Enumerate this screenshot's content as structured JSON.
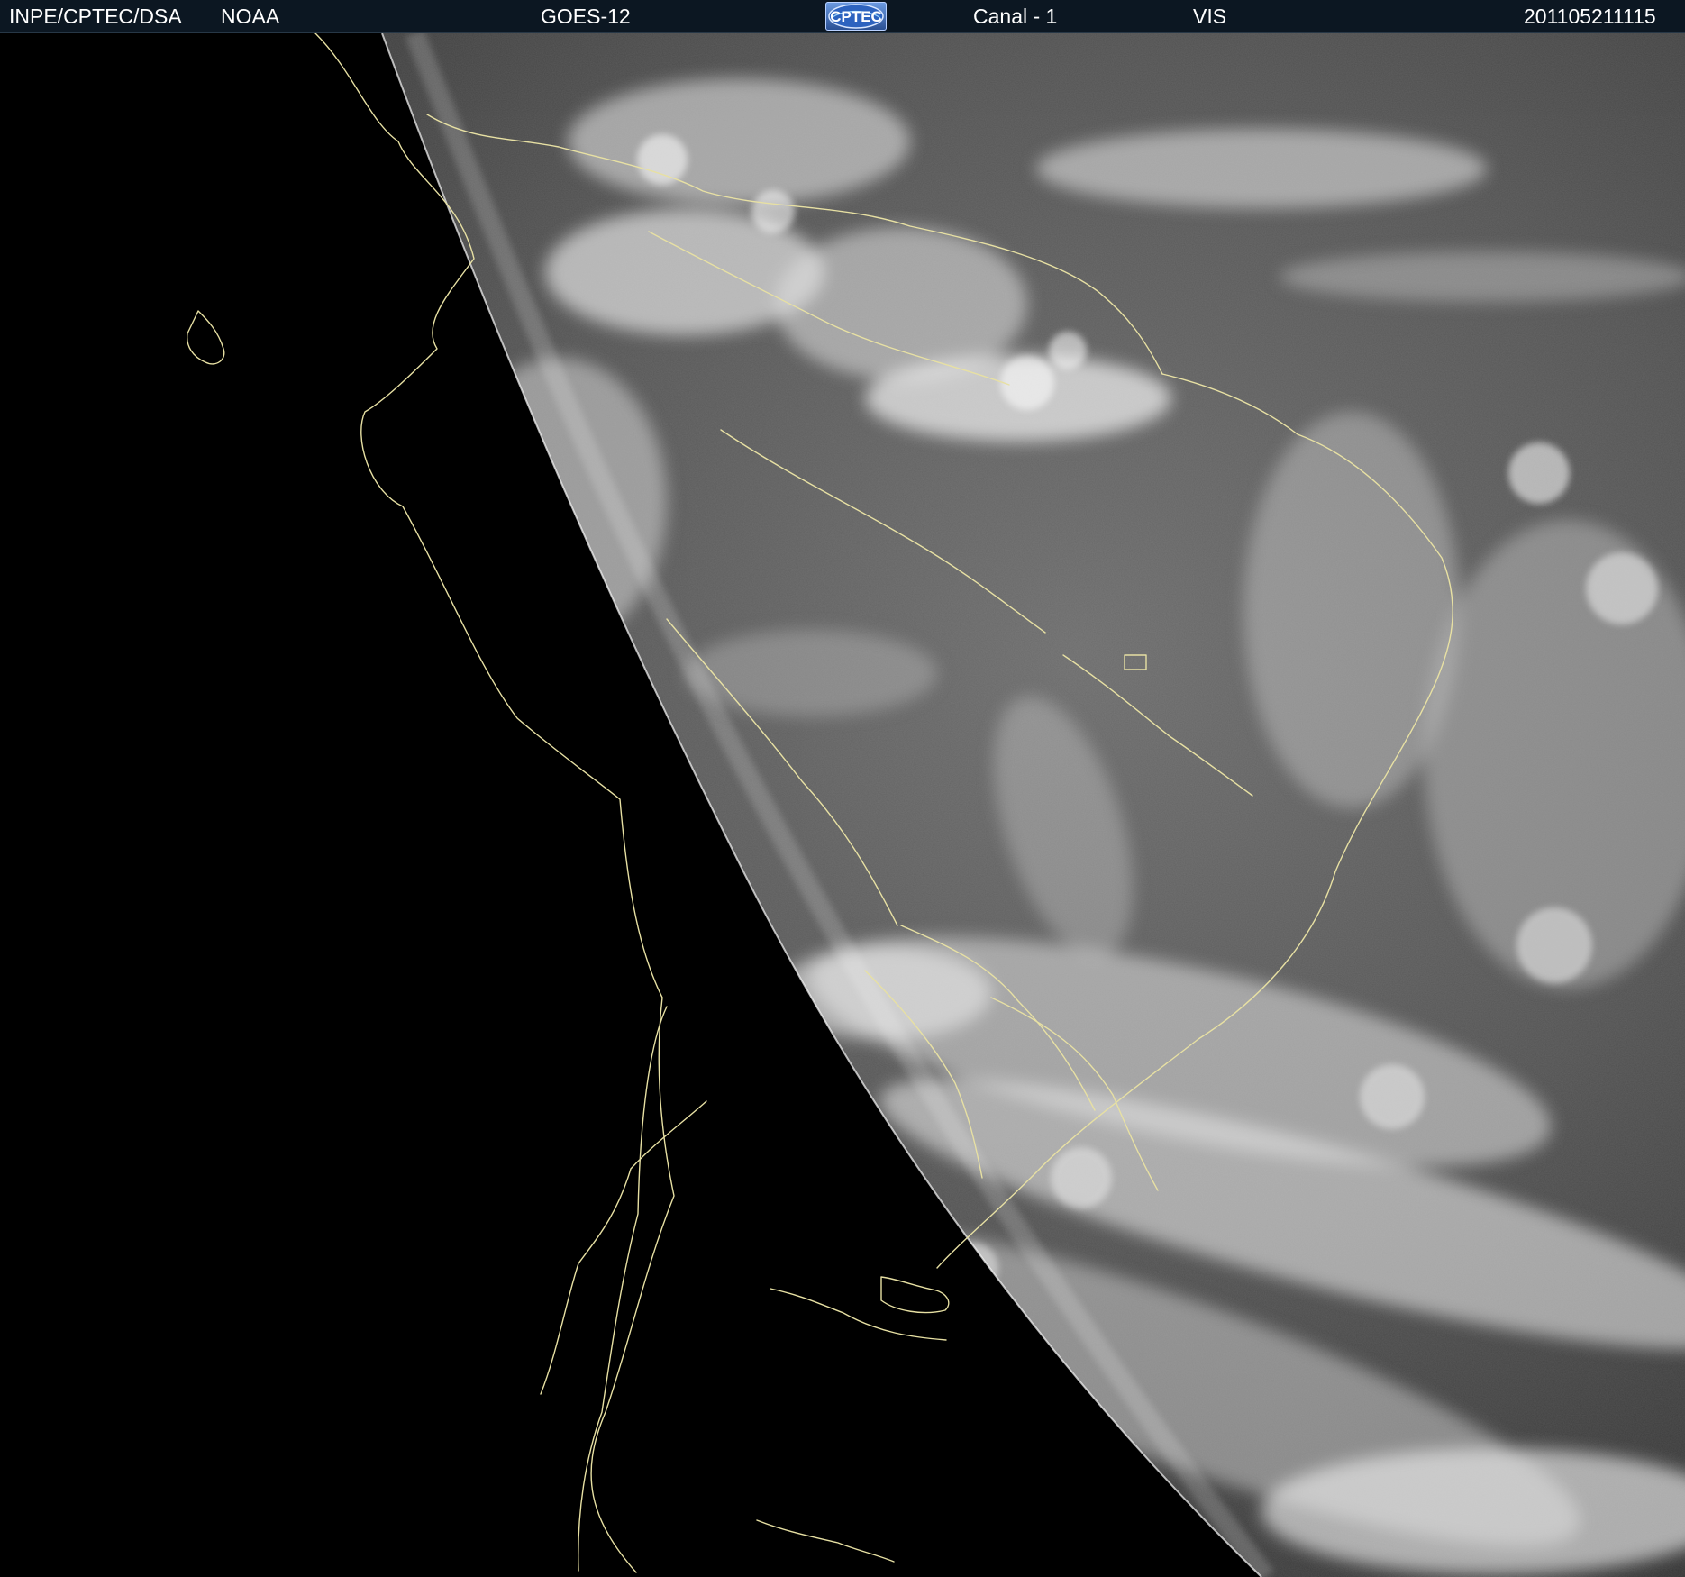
{
  "header": {
    "agency": "INPE/CPTEC/DSA",
    "source": "NOAA",
    "satellite": "GOES-12",
    "logo_text": "CPTEC",
    "channel": "Canal - 1",
    "band": "VIS",
    "timestamp": "201105211115"
  },
  "colors": {
    "header_bg": "#0c1722",
    "header_text": "#ffffff",
    "space": "#000000",
    "earth_base": "#5b5b5b",
    "coastline": "#e7e0a3",
    "logo_blue": "#3b67b6"
  },
  "icons": {
    "logo": "cptec-logo-icon"
  }
}
